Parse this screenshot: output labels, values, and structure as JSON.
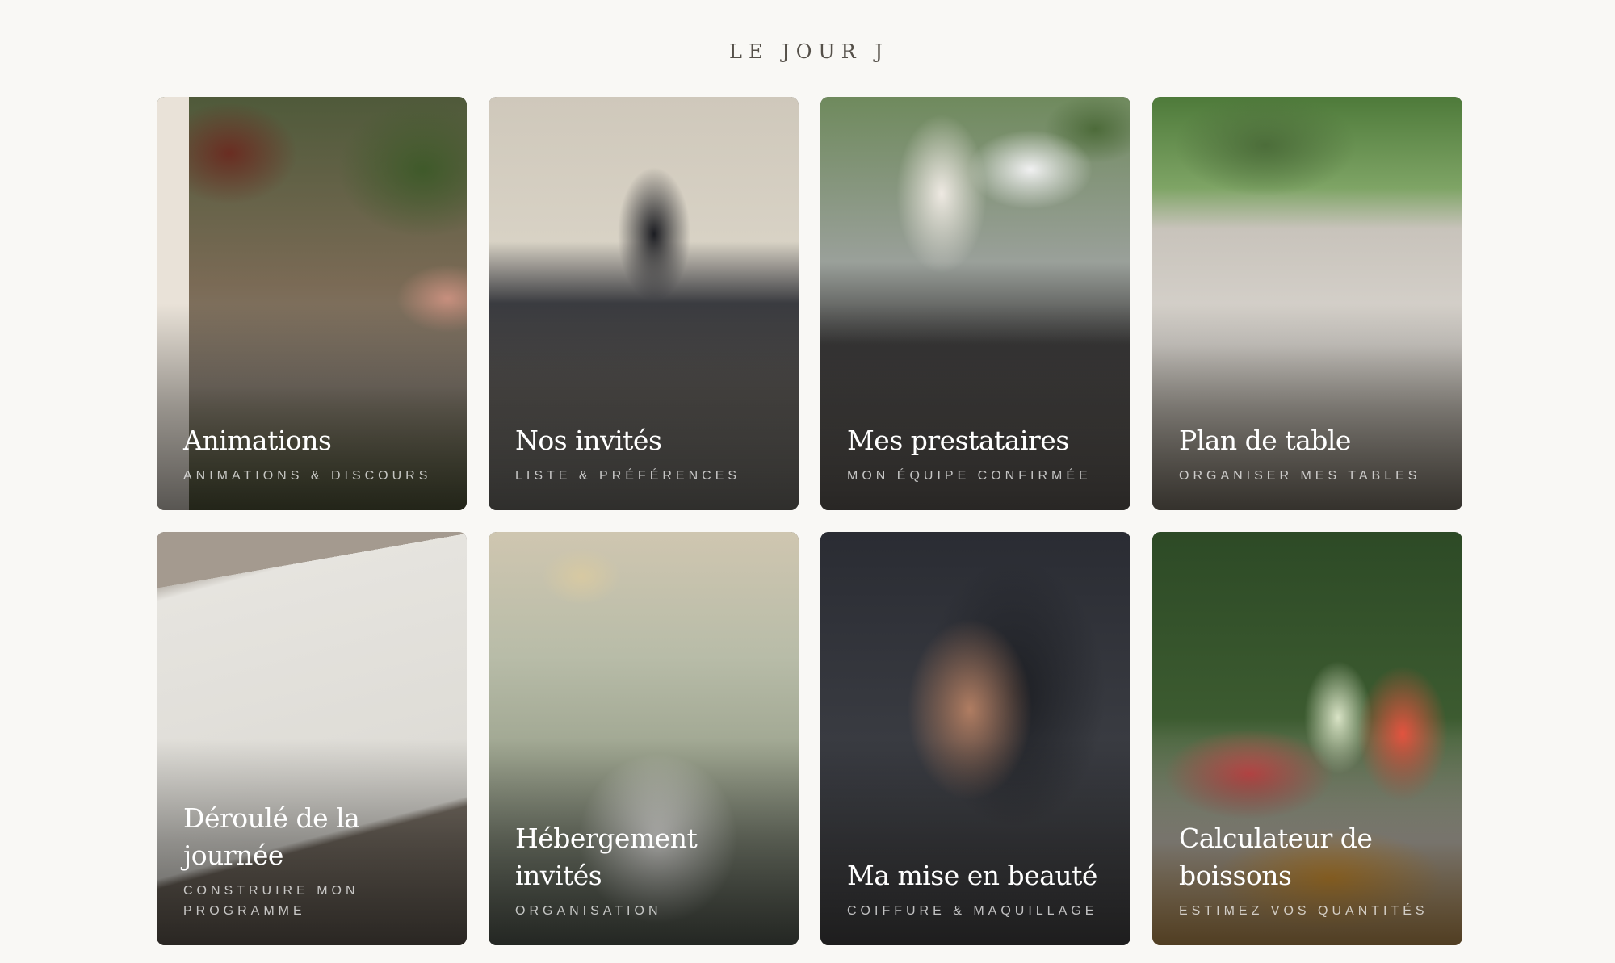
{
  "section": {
    "title": "LE JOUR J"
  },
  "cards": [
    {
      "title": "Animations",
      "subtitle": "ANIMATIONS & DISCOURS"
    },
    {
      "title": "Nos invités",
      "subtitle": "LISTE & PRÉFÉRENCES"
    },
    {
      "title": "Mes prestataires",
      "subtitle": "MON ÉQUIPE CONFIRMÉE"
    },
    {
      "title": "Plan de table",
      "subtitle": "ORGANISER MES TABLES"
    },
    {
      "title": "Déroulé de la journée",
      "subtitle": "CONSTRUIRE MON PROGRAMME"
    },
    {
      "title": "Hébergement invités",
      "subtitle": "ORGANISATION"
    },
    {
      "title": "Ma mise en beauté",
      "subtitle": "COIFFURE & MAQUILLAGE"
    },
    {
      "title": "Calculateur de boissons",
      "subtitle": "ESTIMEZ VOS QUANTITÉS"
    }
  ]
}
